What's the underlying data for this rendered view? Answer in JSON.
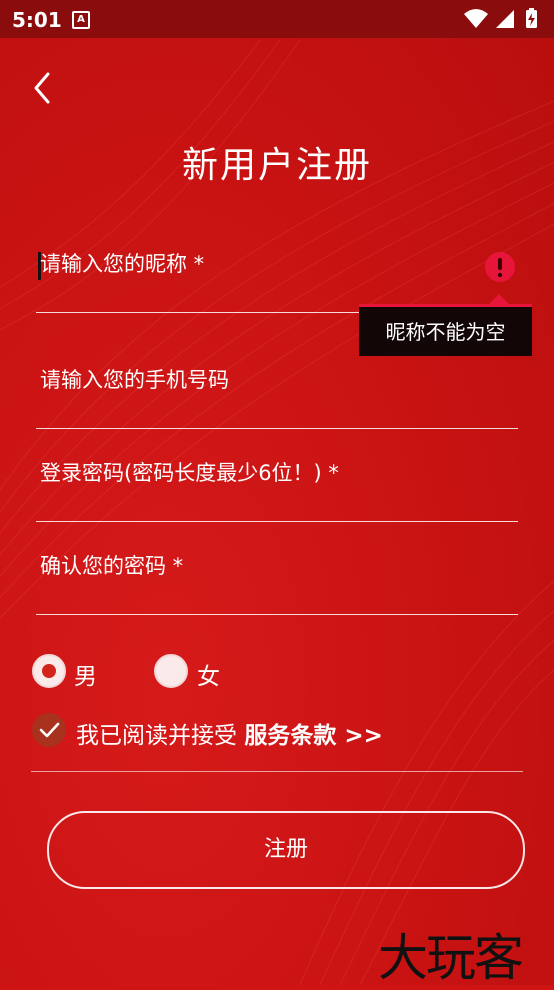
{
  "status_bar": {
    "time": "5:01",
    "a_icon": "A"
  },
  "header": {
    "title": "新用户注册"
  },
  "form": {
    "nickname_placeholder": "请输入您的昵称 *",
    "phone_placeholder": "请输入您的手机号码",
    "password_placeholder": "登录密码(密码长度最少6位！) *",
    "confirm_placeholder": "确认您的密码 *",
    "nickname_error": "昵称不能为空"
  },
  "gender": {
    "options": [
      {
        "label": "男",
        "selected": true
      },
      {
        "label": "女",
        "selected": false
      }
    ]
  },
  "agreement": {
    "checked": true,
    "text": "我已阅读并接受",
    "link": "服务条款 >>"
  },
  "register": {
    "label": "注册"
  },
  "watermark": {
    "text": "大玩客"
  },
  "colors": {
    "background": "#cf1414",
    "status_bar": "#8b0c0c",
    "error": "#e8153a",
    "tooltip": "#120606"
  }
}
